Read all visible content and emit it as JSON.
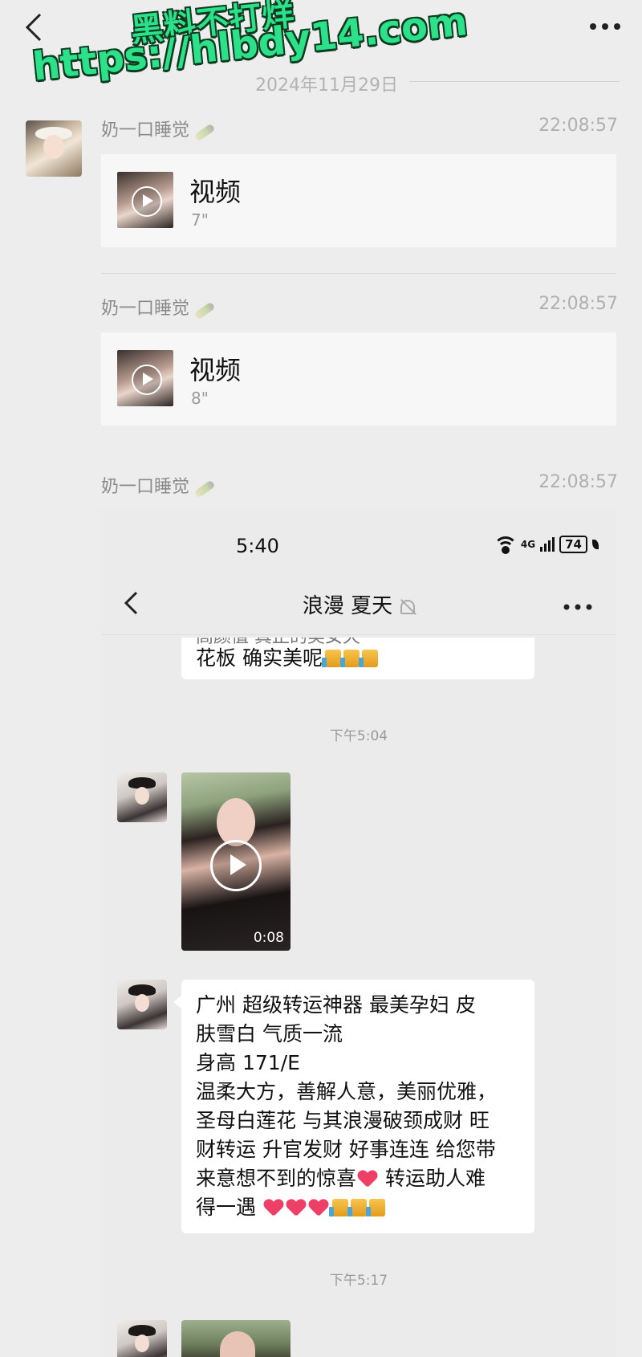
{
  "watermark": {
    "line1": "黑料不打烊",
    "line2": "https://hlbdy14.com"
  },
  "chat": {
    "date": "2024年11月29日",
    "messages": [
      {
        "sender": "奶一口睡觉",
        "time": "22:08:57",
        "type": "video",
        "label": "视频",
        "duration": "7\""
      },
      {
        "sender": "奶一口睡觉",
        "time": "22:08:57",
        "type": "video",
        "label": "视频",
        "duration": "8\""
      },
      {
        "sender": "奶一口睡觉",
        "time": "22:08:57",
        "type": "image"
      }
    ]
  },
  "screenshot": {
    "status_time": "5:40",
    "network": "4G",
    "battery": "74",
    "title": "浪漫 夏天",
    "cut_top_text": "高颜值 真正的美女天",
    "cut_bubble_text": "花板 确实美呢",
    "time1": "下午5:04",
    "video_duration": "0:08",
    "long_message": {
      "l1": "广州   超级转运神器 最美孕妇 皮",
      "l2": "肤雪白 气质一流",
      "l3": "身高 171/E",
      "l4": "温柔大方，善解人意，美丽优雅，",
      "l5": "圣母白莲花 与其浪漫破颈成财 旺",
      "l6": "财转运 升官发财 好事连连 给您带",
      "l7a": "来意想不到的惊喜",
      "l7b": " 转运助人难",
      "l8": "得一遇 "
    },
    "time2": "下午5:17"
  },
  "icons": {
    "back": "chevron-left-icon",
    "more": "more-dots-icon",
    "play": "play-icon",
    "mute": "mute-bell-icon"
  }
}
